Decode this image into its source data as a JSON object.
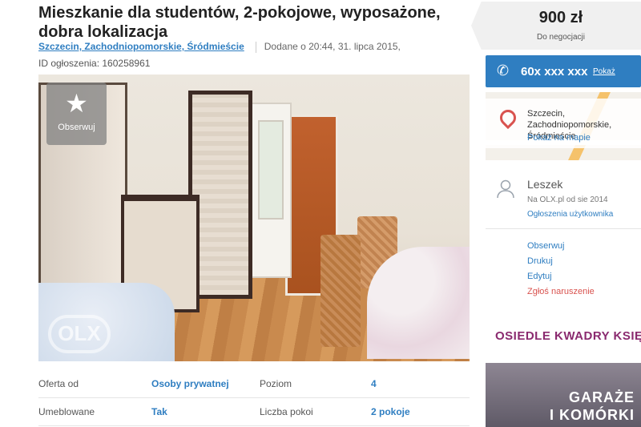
{
  "listing": {
    "title": "Mieszkanie dla studentów, 2-pokojowe, wyposażone, dobra lokalizacja",
    "location": "Szczecin, Zachodniopomorskie, Śródmieście",
    "added": "Dodane o 20:44, 31. lipca 2015,",
    "ad_id": "ID ogłoszenia: 160258961"
  },
  "photo": {
    "observe_label": "Obserwuj",
    "star_icon": "star-icon",
    "watermark": "OLX"
  },
  "params": [
    {
      "label": "Oferta od",
      "value": "Osoby prywatnej",
      "label2": "Poziom",
      "value2": "4"
    },
    {
      "label": "Umeblowane",
      "value": "Tak",
      "label2": "Liczba pokoi",
      "value2": "2 pokoje"
    }
  ],
  "sidebar": {
    "price": "900 zł",
    "negotiable": "Do negocjacji",
    "phone_icon": "phone-icon",
    "phone_number": "60x xxx xxx",
    "phone_show": "Pokaż",
    "map_city_1": "Szczecin, Zachodniopomorskie,",
    "map_city_2": "Śródmieście",
    "map_link": "Pokaż na mapie",
    "user_name": "Leszek",
    "user_since": "Na OLX.pl od sie 2014",
    "user_ads": "Ogłoszenia użytkownika",
    "actions": [
      "Obserwuj",
      "Drukuj",
      "Edytuj",
      "Zgłoś naruszenie"
    ],
    "banner_top": "OSIEDLE KWADRY KSIĘŻYCA",
    "banner_line1": "GARAŻE",
    "banner_line2": "I KOMÓRKI",
    "colors": {
      "accent": "#2f7ec1",
      "report": "#d9534f",
      "banner": "#8a2a6f"
    }
  }
}
